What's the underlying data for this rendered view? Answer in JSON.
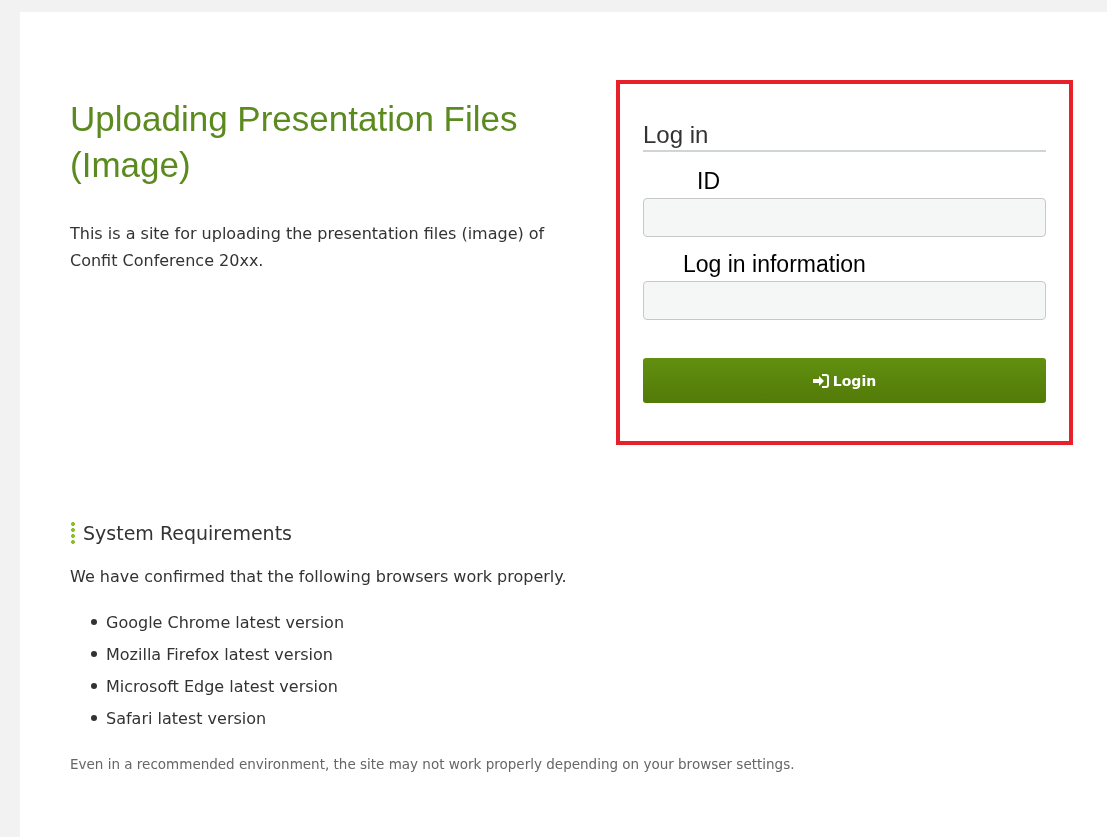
{
  "title": "Uploading Presentation Files (Image)",
  "intro": "This is a site for uploading the presentation files (image) of Confit Conference 20xx.",
  "login": {
    "heading": "Log in",
    "highlighted": true,
    "fields": [
      {
        "label": "ID"
      },
      {
        "label": "Log in information"
      }
    ],
    "button": "Login"
  },
  "requirements": {
    "heading": "System Requirements",
    "text": "We have confirmed that the following browsers work properly.",
    "items": [
      "Google Chrome latest version",
      "Mozilla Firefox latest version",
      "Microsoft Edge latest version",
      "Safari latest version"
    ],
    "note": "Even in a recommended environment, the site may not work properly depending on your browser settings."
  }
}
